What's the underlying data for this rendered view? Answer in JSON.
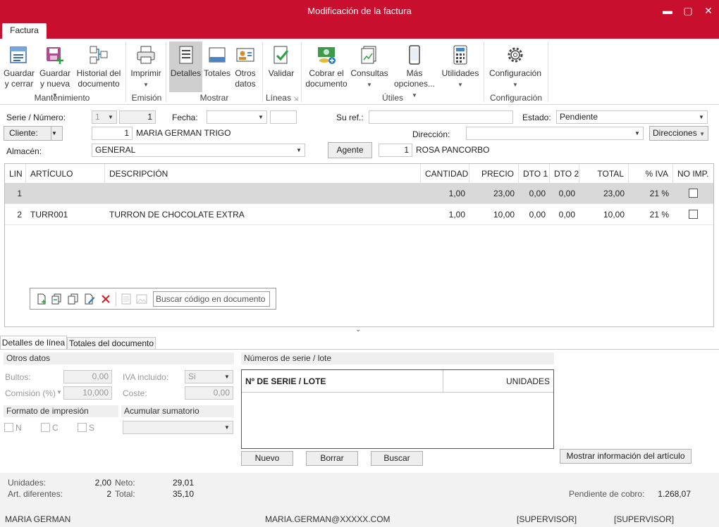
{
  "window": {
    "title": "Modificación de la factura",
    "controls": {
      "minimize": "▬",
      "restore": "▢",
      "close": "✕"
    }
  },
  "tabs": {
    "factura": "Factura"
  },
  "ribbon": {
    "buttons": {
      "guardar_cerrar": "Guardar y cerrar",
      "guardar_nueva": "Guardar y nueva",
      "historial": "Historial del documento",
      "imprimir": "Imprimir",
      "detalles": "Detalles",
      "totales": "Totales",
      "otros_datos": "Otros datos",
      "validar": "Validar",
      "cobrar": "Cobrar el documento",
      "consultas": "Consultas",
      "mas_opciones": "Más opciones...",
      "utilidades": "Utilidades",
      "configuracion": "Configuración"
    },
    "groups": {
      "mantenimiento": "Mantenimiento",
      "emision": "Emisión",
      "mostrar": "Mostrar",
      "lineas": "Líneas",
      "utiles": "Útiles",
      "configuracion": "Configuración"
    }
  },
  "form": {
    "serie_label": "Serie / Número:",
    "serie_value": "1",
    "numero_value": "1",
    "fecha_label": "Fecha:",
    "fecha_value": "",
    "su_ref_label": "Su ref.:",
    "su_ref_value": "",
    "estado_label": "Estado:",
    "estado_value": "Pendiente",
    "cliente_label": "Cliente:",
    "cliente_code": "1",
    "cliente_name": "MARIA GERMAN TRIGO",
    "direccion_label": "Dirección:",
    "direccion_value": "",
    "direcciones_button": "Direcciones",
    "almacen_label": "Almacén:",
    "almacen_value": "GENERAL",
    "agente_button": "Agente",
    "agente_code": "1",
    "agente_name": "ROSA PANCORBO"
  },
  "grid": {
    "headers": [
      "LIN",
      "ARTÍCULO",
      "DESCRIPCIÓN",
      "CANTIDAD",
      "PRECIO",
      "DTO 1",
      "DTO 2",
      "TOTAL",
      "% IVA",
      "NO IMP."
    ],
    "rows": [
      {
        "lin": "1",
        "articulo": "",
        "descripcion": "",
        "cantidad": "1,00",
        "precio": "23,00",
        "dto1": "0,00",
        "dto2": "0,00",
        "total": "23,00",
        "iva": "21 %",
        "noimp": false
      },
      {
        "lin": "2",
        "articulo": "TURR001",
        "descripcion": "TURRON DE CHOCOLATE EXTRA",
        "cantidad": "1,00",
        "precio": "10,00",
        "dto1": "0,00",
        "dto2": "0,00",
        "total": "10,00",
        "iva": "21 %",
        "noimp": false
      }
    ],
    "search_placeholder": "Buscar código en documento"
  },
  "lower": {
    "tabs": [
      "Detalles de línea",
      "Totales del documento"
    ],
    "otros_datos": "Otros datos",
    "bultos_label": "Bultos:",
    "bultos_value": "0,00",
    "iva_incluido_label": "IVA incluido:",
    "iva_incluido_value": "Si",
    "comision_label": "Comisión (%)",
    "comision_value": "10,000",
    "coste_label": "Coste:",
    "coste_value": "0,00",
    "formato_impresion": "Formato de impresión",
    "acumular_sumatorio": "Acumular sumatorio",
    "check_n": "N",
    "check_c": "C",
    "check_s": "S",
    "numeros_serie": "Números de serie / lote",
    "serie_col": "Nº DE SERIE / LOTE",
    "unidades_col": "UNIDADES",
    "nuevo": "Nuevo",
    "borrar": "Borrar",
    "buscar": "Buscar",
    "mostrar_info": "Mostrar información del artículo"
  },
  "summary": {
    "unidades_label": "Unidades:",
    "unidades_value": "2,00",
    "art_dif_label": "Art. diferentes:",
    "art_dif_value": "2",
    "neto_label": "Neto:",
    "neto_value": "29,01",
    "total_label": "Total:",
    "total_value": "35,10",
    "pendiente_label": "Pendiente de cobro:",
    "pendiente_value": "1.268,07"
  },
  "statusbar": {
    "user": "MARIA GERMAN",
    "email": "MARIA.GERMAN@XXXXX.COM",
    "role1": "[SUPERVISOR]",
    "role2": "[SUPERVISOR]"
  },
  "colors": {
    "accent": "#c8102e"
  }
}
